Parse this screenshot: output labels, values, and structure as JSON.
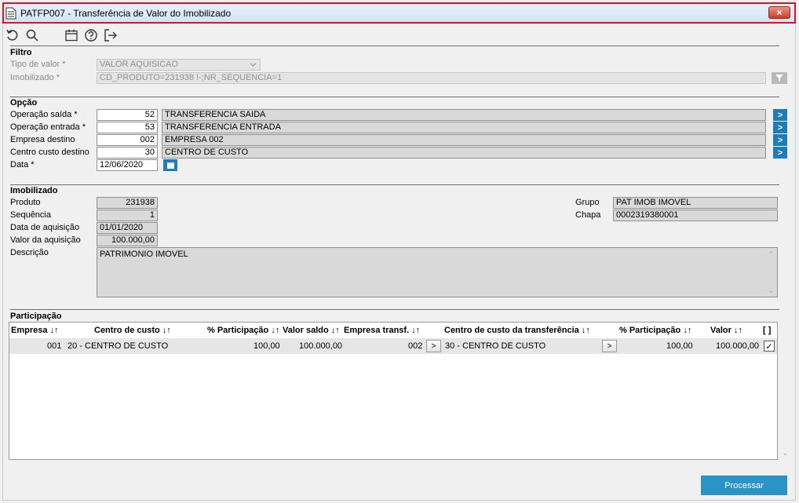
{
  "window": {
    "title": "PATFP007 - Transferência de Valor do Imobilizado",
    "close_label": "×"
  },
  "filtro": {
    "title": "Filtro",
    "tipo_valor_label": "Tipo de valor *",
    "tipo_valor_value": "VALOR AQUISICAO",
    "imobilizado_label": "Imobilizado *",
    "imobilizado_value": "CD_PRODUTO=231938 !-;NR_SEQUENCIA=1"
  },
  "opcao": {
    "title": "Opção",
    "operacao_saida_label": "Operação saída *",
    "operacao_saida_code": "52",
    "operacao_saida_desc": "TRANSFERENCIA SAIDA",
    "operacao_entrada_label": "Operação entrada *",
    "operacao_entrada_code": "53",
    "operacao_entrada_desc": "TRANSFERENCIA ENTRADA",
    "empresa_destino_label": "Empresa destino",
    "empresa_destino_code": "002",
    "empresa_destino_desc": "EMPRESA 002",
    "centro_custo_label": "Centro custo destino",
    "centro_custo_code": "30",
    "centro_custo_desc": "CENTRO DE CUSTO",
    "data_label": "Data *",
    "data_value": "12/06/2020"
  },
  "imobilizado": {
    "title": "Imobilizado",
    "produto_label": "Produto",
    "produto_value": "231938",
    "sequencia_label": "Sequência",
    "sequencia_value": "1",
    "data_aquisicao_label": "Data de aquisição",
    "data_aquisicao_value": "01/01/2020",
    "valor_aquisicao_label": "Valor da aquisição",
    "valor_aquisicao_value": "100.000,00",
    "descricao_label": "Descrição",
    "descricao_value": "PATRIMONIO IMOVEL",
    "grupo_label": "Grupo",
    "grupo_value": "PAT IMOB IMOVEL",
    "chapa_label": "Chapa",
    "chapa_value": "0002319380001"
  },
  "participacao": {
    "title": "Participação",
    "headers": {
      "empresa": "Empresa ↓↑",
      "centro_custo": "Centro de custo ↓↑",
      "pct": "% Participação ↓↑",
      "valor_saldo": "Valor saldo ↓↑",
      "empresa_transf": "Empresa transf. ↓↑",
      "centro_custo_transf": "Centro de custo da transferência ↓↑",
      "pct2": "% Participação ↓↑",
      "valor": "Valor ↓↑",
      "check": "[ ]"
    },
    "rows": [
      {
        "empresa": "001",
        "centro_custo": "20 - CENTRO DE CUSTO",
        "pct": "100,00",
        "valor_saldo": "100.000,00",
        "empresa_transf": "002",
        "btn1": ">",
        "centro_custo_transf": "30 - CENTRO DE CUSTO",
        "btn2": ">",
        "pct2": "100,00",
        "valor": "100.000,00",
        "check": "✓"
      }
    ]
  },
  "actions": {
    "processar_label": "Processar"
  }
}
